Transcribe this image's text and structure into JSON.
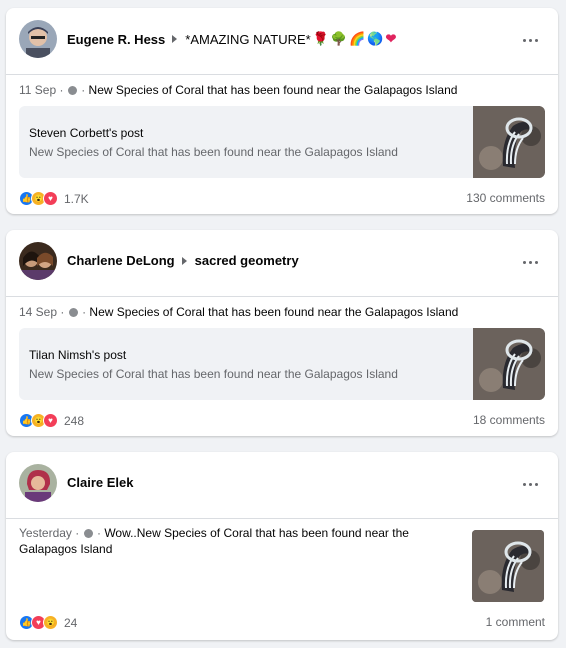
{
  "posts": [
    {
      "author": "Eugene R. Hess",
      "group": "*AMAZING NATURE*",
      "group_emojis": [
        "🌹",
        "🌳",
        "🌈",
        "🌎",
        "❤"
      ],
      "date": "11 Sep",
      "text": "New Species of Coral that has been found near the Galapagos Island",
      "shared": {
        "author_line": "Steven Corbett's post",
        "description": "New Species of Coral that has been found near the Galapagos Island"
      },
      "reactions": [
        "like",
        "wow",
        "love"
      ],
      "reaction_count": "1.7K",
      "comments": "130 comments"
    },
    {
      "author": "Charlene DeLong",
      "group": "sacred geometry",
      "date": "14 Sep",
      "text": "New Species of Coral that has been found near the Galapagos Island",
      "shared": {
        "author_line": "Tilan Nimsh's post",
        "description": "New Species of Coral that has been found near the Galapagos Island"
      },
      "reactions": [
        "like",
        "wow",
        "love"
      ],
      "reaction_count": "248",
      "comments": "18 comments"
    },
    {
      "author": "Claire Elek",
      "date": "Yesterday",
      "text_line1": "Wow..New Species of Coral that has been found near the",
      "text_line2": "Galapagos Island",
      "reactions": [
        "like",
        "love",
        "wow"
      ],
      "reaction_count": "24",
      "comments": "1 comment"
    }
  ],
  "icons": {
    "more": "more-horizontal-icon",
    "privacy": "globe-icon",
    "separator_dot": "·"
  },
  "colors": {
    "background": "#f0f2f5",
    "card": "#ffffff",
    "secondary_text": "#65676b",
    "like": "#1877f2",
    "wow": "#f7b125",
    "love": "#f33e58"
  }
}
